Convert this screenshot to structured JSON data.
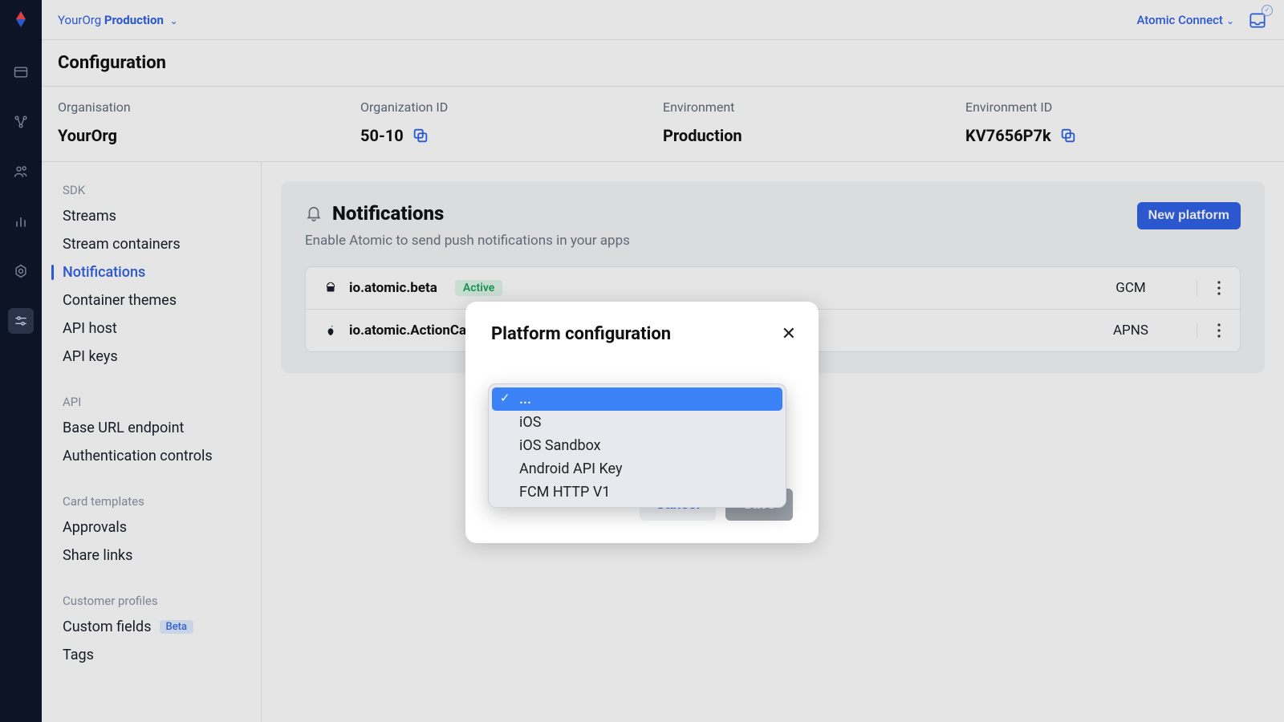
{
  "topbar": {
    "org": "YourOrg",
    "env": "Production",
    "right_link": "Atomic Connect"
  },
  "page": {
    "title": "Configuration"
  },
  "info": {
    "org_label": "Organisation",
    "org_value": "YourOrg",
    "orgid_label": "Organization ID",
    "orgid_value": "50-10",
    "env_label": "Environment",
    "env_value": "Production",
    "envid_label": "Environment ID",
    "envid_value": "KV7656P7k"
  },
  "sidenav": {
    "groups": [
      {
        "title": "SDK",
        "items": [
          "Streams",
          "Stream containers",
          "Notifications",
          "Container themes",
          "API host",
          "API keys"
        ]
      },
      {
        "title": "API",
        "items": [
          "Base URL endpoint",
          "Authentication controls"
        ]
      },
      {
        "title": "Card templates",
        "items": [
          "Approvals",
          "Share links"
        ]
      },
      {
        "title": "Customer profiles",
        "items": [
          "Custom fields",
          "Tags"
        ]
      }
    ],
    "active": "Notifications",
    "beta_label": "Beta"
  },
  "main": {
    "section_title": "Notifications",
    "section_subtitle": "Enable Atomic to send push notifications in your apps",
    "new_button": "New platform",
    "platforms": [
      {
        "id": "io.atomic.beta",
        "status": "Active",
        "service": "GCM",
        "os": "android"
      },
      {
        "id": "io.atomic.ActionCards",
        "status": "",
        "service": "APNS",
        "os": "apple"
      }
    ]
  },
  "modal": {
    "title": "Platform configuration",
    "cancel": "Cancel",
    "save": "Save"
  },
  "select": {
    "options": [
      "...",
      "iOS",
      "iOS Sandbox",
      "Android API Key",
      "FCM HTTP V1"
    ],
    "selected": "..."
  }
}
